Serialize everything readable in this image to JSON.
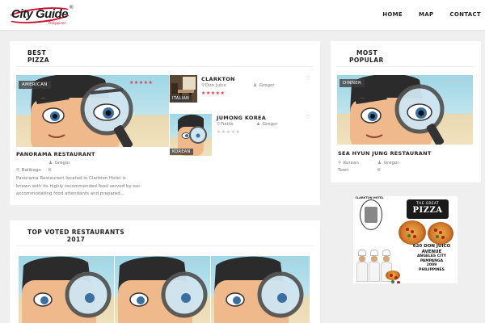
{
  "header": {
    "logo_text": "City Guide",
    "logo_sub": "Philippines",
    "logo_mark": "®",
    "nav": [
      "HOME",
      "MAP",
      "CONTACT"
    ]
  },
  "best_pizza": {
    "title_line1": "BEST",
    "title_line2": "PIZZA",
    "featured": {
      "tag": "AMERICAN",
      "rating": 5,
      "name": "PANORAMA RESTAURANT",
      "owner": "Gregor",
      "location_line1": "Balibago",
      "location_line2": "K",
      "description_lines": [
        "Panorama Restaurant located in Clarkton Hotel is",
        "known with its highly recommended food served by our",
        "accommodating food attendants and prepared..."
      ]
    },
    "side": [
      {
        "name": "CLARKTON",
        "location": "Don Juico",
        "owner": "Gregor",
        "tag": "ITALIAN",
        "rating": 5
      },
      {
        "name": "JUMONG KOREA",
        "location": "Fields",
        "owner": "Gregor",
        "tag": "KOREAN",
        "rating": 0
      }
    ]
  },
  "most_popular": {
    "title_line1": "MOST",
    "title_line2": "POPULAR",
    "tag": "DINNER",
    "rating": 0,
    "name": "SEA HYUN JUNG RESTAURANT",
    "location_line1": "Korean",
    "location_line2": "Town",
    "owner_line1": "Gregor",
    "owner_line2": "K"
  },
  "top_voted": {
    "title_line1": "TOP VOTED RESTAURANTS",
    "title_line2": "2017"
  },
  "ad": {
    "badge": "CLARKTON HOTEL",
    "banner_top": "THE GREAT",
    "banner_big": "PIZZA",
    "address_line1": "620 DON JUICO AVENUE",
    "address_line2": "ANGELES CITY",
    "address_line3": "PAMPANGA",
    "address_line4": "2009",
    "address_line5": "PHILIPPINES"
  },
  "icons": {
    "pin": "location-pin-icon",
    "user": "user-icon",
    "heart": "heart-icon",
    "star": "star-icon"
  },
  "colors": {
    "accent_red": "#e0393e",
    "logo_red": "#c8102e",
    "tag_bg": "#3c3c3c",
    "page_bg": "#efefef"
  }
}
